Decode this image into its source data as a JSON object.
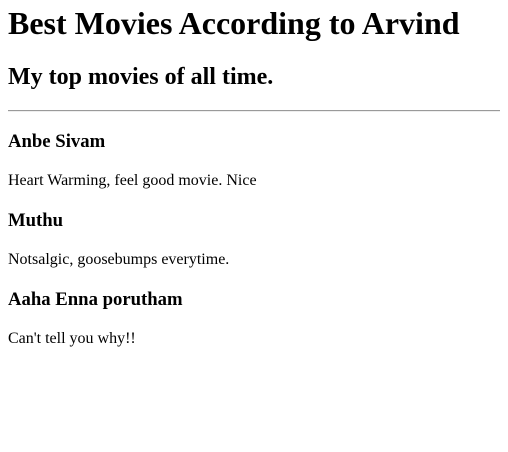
{
  "page": {
    "title": "Best Movies According to Arvind",
    "subtitle": "My top movies of all time."
  },
  "movies": [
    {
      "title": "Anbe Sivam",
      "description": "Heart Warming, feel good movie. Nice"
    },
    {
      "title": "Muthu",
      "description": "Notsalgic, goosebumps everytime."
    },
    {
      "title": "Aaha Enna porutham",
      "description": "Can't tell you why!!"
    }
  ]
}
